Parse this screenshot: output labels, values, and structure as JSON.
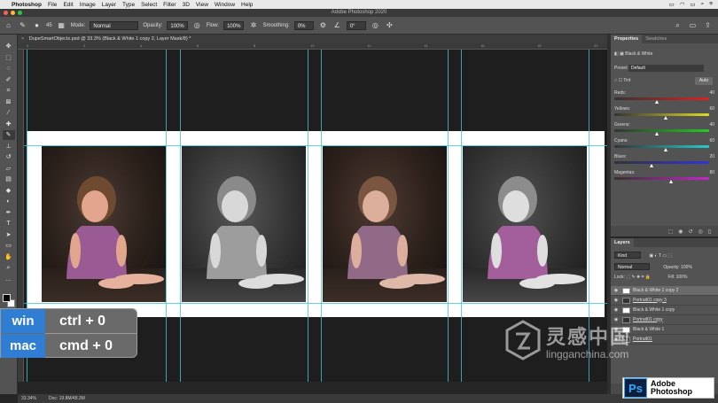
{
  "menubar": {
    "app": "Photoshop",
    "items": [
      "File",
      "Edit",
      "Image",
      "Layer",
      "Type",
      "Select",
      "Filter",
      "3D",
      "View",
      "Window",
      "Help"
    ]
  },
  "window": {
    "title": "Adobe Photoshop 2020"
  },
  "options": {
    "brush_size": "45",
    "mode_label": "Mode:",
    "mode_value": "Normal",
    "opacity_label": "Opacity:",
    "opacity_value": "100%",
    "flow_label": "Flow:",
    "flow_value": "100%",
    "smoothing_label": "Smoothing:",
    "smoothing_value": "0%",
    "angle_value": "0°"
  },
  "document": {
    "tab_title": "DupeSmartObjects.psd @ 33.3% (Black & White 1 copy 2, Layer Mask/8) *",
    "ruler_ticks": [
      "0",
      "2",
      "4",
      "6",
      "8",
      "10",
      "12",
      "14",
      "16",
      "18",
      "20"
    ]
  },
  "status": {
    "zoom": "33.34%",
    "doc_size": "Doc: 19.8M/48.3M"
  },
  "shortcut": {
    "win_label": "win",
    "win_keys": "ctrl + 0",
    "mac_label": "mac",
    "mac_keys": "cmd + 0"
  },
  "properties": {
    "tab_properties": "Properties",
    "tab_swatches": "Swatches",
    "adjustment_name": "Black & White",
    "preset_label": "Preset:",
    "preset_value": "Default",
    "tint_label": "Tint",
    "auto_label": "Auto",
    "sliders": [
      {
        "name": "Reds:",
        "value": "40",
        "pos": 0.45,
        "gradient": "linear-gradient(90deg,#333,#d22)"
      },
      {
        "name": "Yellows:",
        "value": "60",
        "pos": 0.55,
        "gradient": "linear-gradient(90deg,#333,#dd2)"
      },
      {
        "name": "Greens:",
        "value": "40",
        "pos": 0.45,
        "gradient": "linear-gradient(90deg,#333,#2c2)"
      },
      {
        "name": "Cyans:",
        "value": "60",
        "pos": 0.55,
        "gradient": "linear-gradient(90deg,#333,#2cc)"
      },
      {
        "name": "Blues:",
        "value": "20",
        "pos": 0.4,
        "gradient": "linear-gradient(90deg,#333,#33d)"
      },
      {
        "name": "Magentas:",
        "value": "80",
        "pos": 0.6,
        "gradient": "linear-gradient(90deg,#333,#c2c)"
      }
    ]
  },
  "layers": {
    "title": "Layers",
    "kind_label": "Kind",
    "blend_mode": "Normal",
    "opacity_label": "Opacity:",
    "opacity_value": "100%",
    "lock_label": "Lock:",
    "fill_label": "Fill:",
    "fill_value": "100%",
    "items": [
      {
        "name": "Black & White 1 copy 2",
        "selected": true,
        "underline": false,
        "dark": false
      },
      {
        "name": "Portrait01 copy 3",
        "selected": false,
        "underline": true,
        "dark": true
      },
      {
        "name": "Black & White 1 copy",
        "selected": false,
        "underline": false,
        "dark": false
      },
      {
        "name": "Portrait01 copy",
        "selected": false,
        "underline": true,
        "dark": true
      },
      {
        "name": "Black & White 1",
        "selected": false,
        "underline": false,
        "dark": false
      },
      {
        "name": "Portrait01",
        "selected": false,
        "underline": true,
        "dark": true
      }
    ]
  },
  "logo": {
    "mark": "Ps",
    "line1": "Adobe",
    "line2": "Photoshop"
  },
  "watermark": {
    "cn": "灵感中国",
    "en": "lingganchina.com"
  },
  "colors": {
    "accent_blue": "#2f7ed4",
    "guide_cyan": "#3fc5d6",
    "panel_bg": "#535353"
  }
}
